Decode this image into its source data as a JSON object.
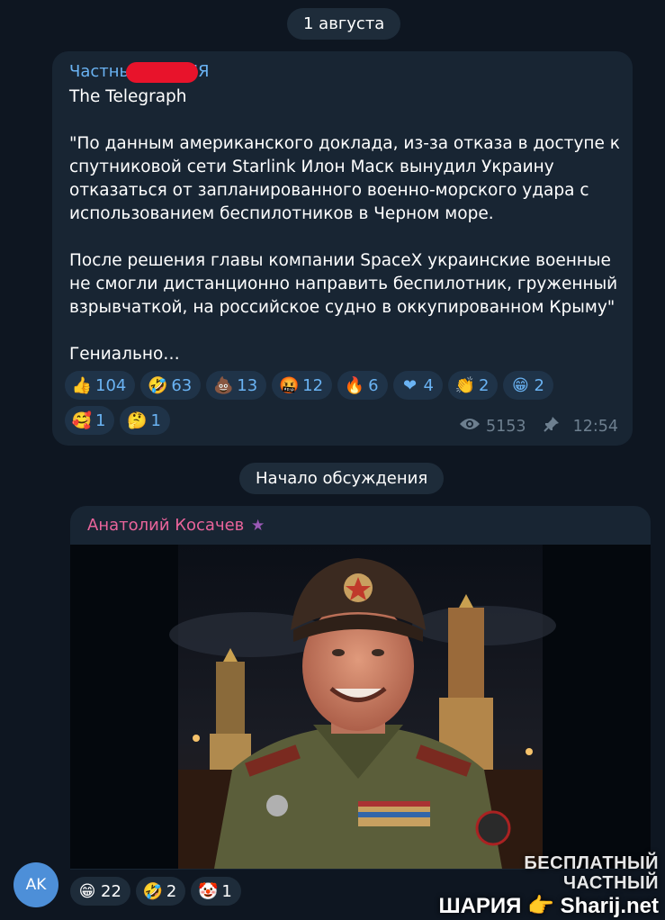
{
  "date_pill": "1 августа",
  "post": {
    "channel_name": "Частный ШАРИЯ",
    "text": "The Telegraph\n\n\"По данным американского доклада, из-за отказа в доступе к спутниковой сети Starlink Илон Маск вынудил Украину отказаться от запланированного военно-морского удара с использованием беспилотников в Черном море.\n\nПосле решения главы компании SpaceX украинские военные не смогли дистанционно направить беспилотник, груженный взрывчаткой, на российское судно в оккупированном Крыму\"\n\nГениально…",
    "reactions": [
      {
        "emoji": "thumbs-up",
        "glyph": "👍",
        "count": "104"
      },
      {
        "emoji": "rofl",
        "glyph": "🤣",
        "count": "63"
      },
      {
        "emoji": "poo",
        "glyph": "💩",
        "count": "13"
      },
      {
        "emoji": "angry-swearing",
        "glyph": "🤬",
        "count": "12"
      },
      {
        "emoji": "fire",
        "glyph": "🔥",
        "count": "6"
      },
      {
        "emoji": "heart",
        "glyph": "❤",
        "count": "4"
      },
      {
        "emoji": "clap",
        "glyph": "👏",
        "count": "2"
      },
      {
        "emoji": "grin",
        "glyph": "😁",
        "count": "2"
      },
      {
        "emoji": "smiling-hearts",
        "glyph": "🥰",
        "count": "1"
      },
      {
        "emoji": "thinking",
        "glyph": "🤔",
        "count": "1"
      }
    ],
    "views": "5153",
    "time": "12:54"
  },
  "discussion_pill": "Начало обсуждения",
  "comment": {
    "author": "Анатолий Косачев",
    "avatar_initials": "AK",
    "reactions": [
      {
        "emoji": "grin",
        "glyph": "😁",
        "count": "22"
      },
      {
        "emoji": "rofl",
        "glyph": "🤣",
        "count": "2"
      },
      {
        "emoji": "clown",
        "glyph": "🤡",
        "count": "1"
      }
    ]
  },
  "watermark": {
    "line1": "БЕСПЛАТНЫЙ ЧАСТНЫЙ",
    "line2": "ШАРИЯ 👉 Sharij.net"
  },
  "colors": {
    "background": "#0e1621",
    "bubble": "#182533",
    "link": "#6ab3f3",
    "author": "#e9649b",
    "redaction": "#e8132b"
  }
}
